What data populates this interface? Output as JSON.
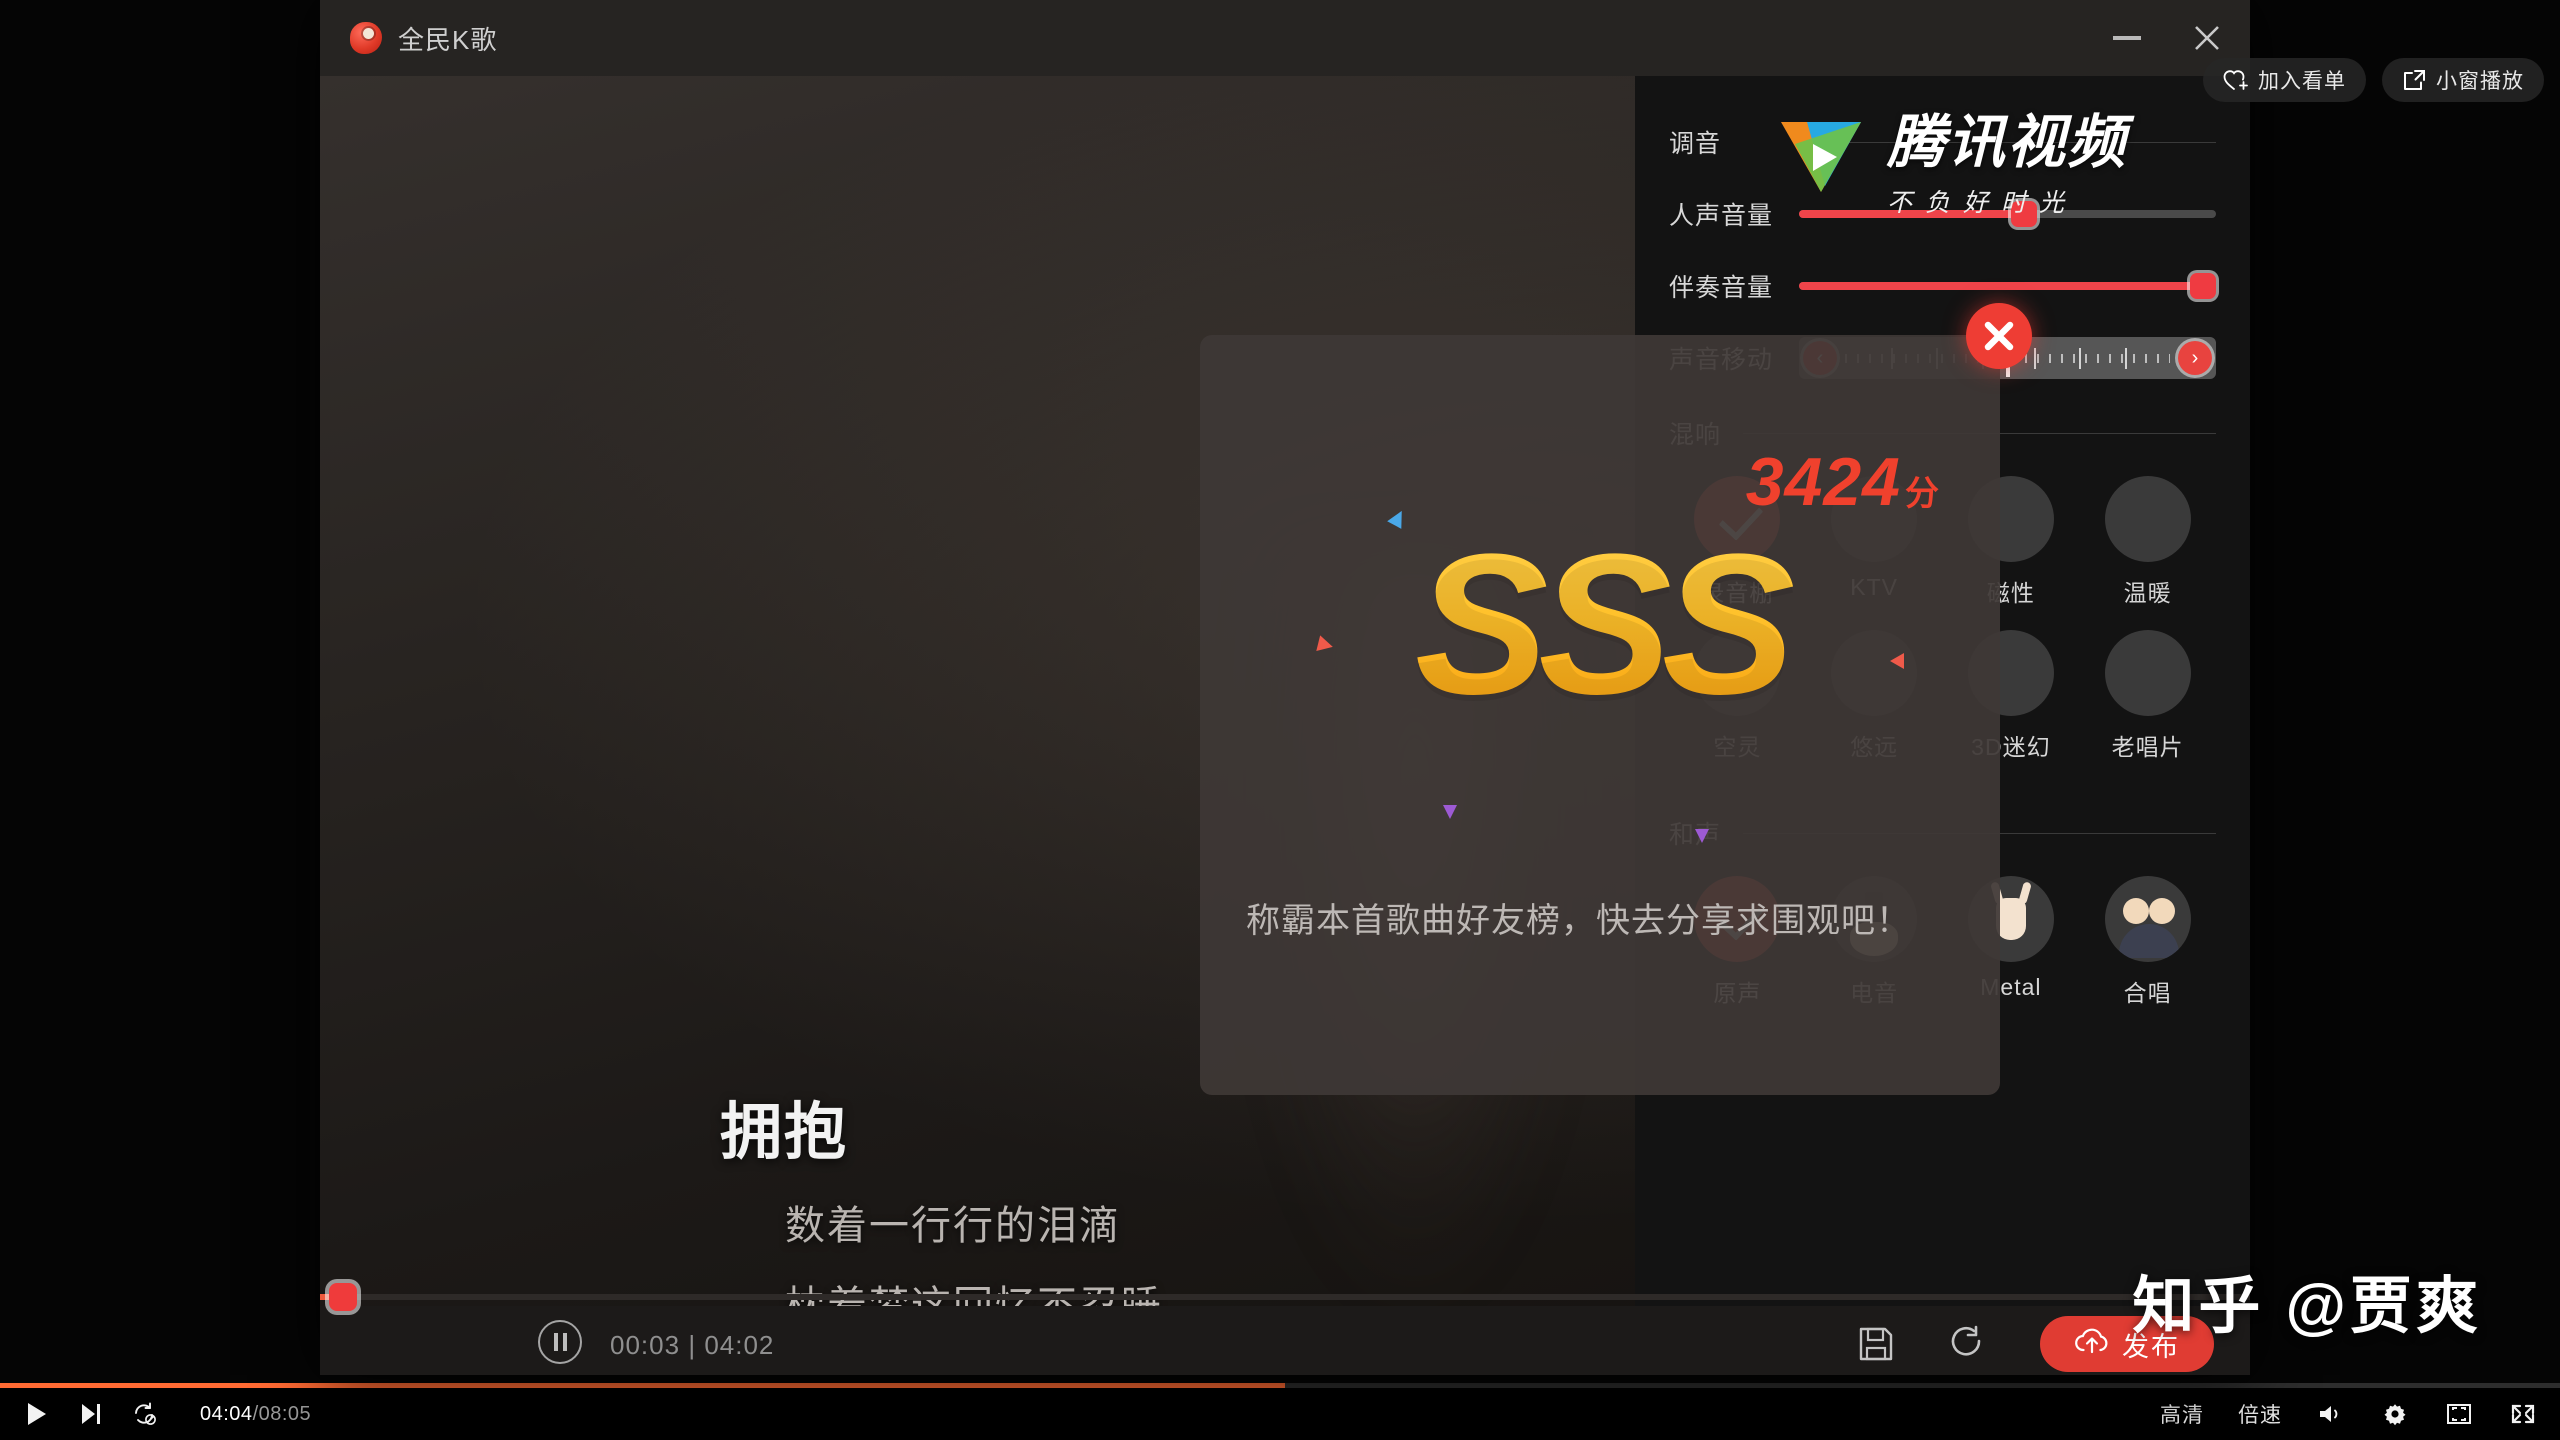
{
  "outer_player": {
    "top_buttons": [
      {
        "label": "加入看单",
        "icon": "heart-plus-icon"
      },
      {
        "label": "小窗播放",
        "icon": "popout-window-icon"
      }
    ],
    "controls": {
      "play_icon": "play-icon",
      "next_icon": "next-track-icon",
      "loop_icon": "loop-off-icon",
      "current_time": "04:04",
      "separator": "/",
      "total_time": "08:05",
      "quality_label": "高清",
      "speed_label": "倍速",
      "volume_icon": "volume-icon",
      "settings_icon": "gear-icon",
      "fullscreen_icon": "fullscreen-icon",
      "web_fullscreen_icon": "web-fullscreen-icon"
    },
    "progress_percent": 50.2,
    "progress_color": "#ff6a33"
  },
  "brand": {
    "name": "腾讯视频",
    "slogan": "不负好时光",
    "logo_icon": "tencent-video-logo"
  },
  "watermark": {
    "text": "知乎 @贾爽"
  },
  "app_window": {
    "title": "全民K歌",
    "logo_icon": "kge-app-icon",
    "minimize_icon": "minimize-icon",
    "close_icon": "close-icon"
  },
  "lyrics": {
    "current": "拥抱",
    "lines": [
      "数着一行行的泪滴",
      "枕着梦这回忆不忍睡"
    ]
  },
  "tuning_panel": {
    "rows": [
      {
        "label": "调音",
        "type": "divider"
      },
      {
        "label": "人声音量",
        "type": "slider",
        "value": 54
      },
      {
        "label": "伴奏音量",
        "type": "slider",
        "value": 97
      },
      {
        "label": "声音移动",
        "type": "pitch",
        "value": 50,
        "left_icon": "chevron-left-icon",
        "right_icon": "chevron-right-icon"
      }
    ],
    "sections": [
      {
        "title": "混响",
        "items": [
          {
            "name": "录音棚",
            "selected": true,
            "thumb": "selected"
          },
          {
            "name": "KTV",
            "selected": false,
            "thumb": "t-ktv"
          },
          {
            "name": "磁性",
            "selected": false,
            "thumb": "t-cixing"
          },
          {
            "name": "温暖",
            "selected": false,
            "thumb": "t-nuan"
          },
          {
            "name": "空灵",
            "selected": false,
            "thumb": "t-kong"
          },
          {
            "name": "悠远",
            "selected": false,
            "thumb": "t-youyuan"
          },
          {
            "name": "3D迷幻",
            "selected": false,
            "thumb": "t-3d"
          },
          {
            "name": "老唱片",
            "selected": false,
            "thumb": "t-old"
          }
        ]
      },
      {
        "title": "和声",
        "items": [
          {
            "name": "原声",
            "selected": true,
            "thumb": "selected"
          },
          {
            "name": "电音",
            "selected": false,
            "thumb": "guitar"
          },
          {
            "name": "Metal",
            "selected": false,
            "thumb": "horns"
          },
          {
            "name": "合唱",
            "selected": false,
            "thumb": "duo"
          }
        ]
      }
    ]
  },
  "app_controls": {
    "pause_icon": "pause-icon",
    "current_time": "00:03",
    "separator": "|",
    "total_time": "04:02",
    "progress_percent": 1.2,
    "save_icon": "save-icon",
    "redo_icon": "restart-icon",
    "publish_label": "发布",
    "publish_icon": "upload-cloud-icon",
    "publish_color": "#e03c33"
  },
  "result_dialog": {
    "close_icon": "close-circle-icon",
    "score": "3424",
    "score_unit": "分",
    "rank": "SSS",
    "message": "称霸本首歌曲好友榜，快去分享求围观吧！",
    "score_color": "#f0412d",
    "rank_color": "#fdb515"
  }
}
